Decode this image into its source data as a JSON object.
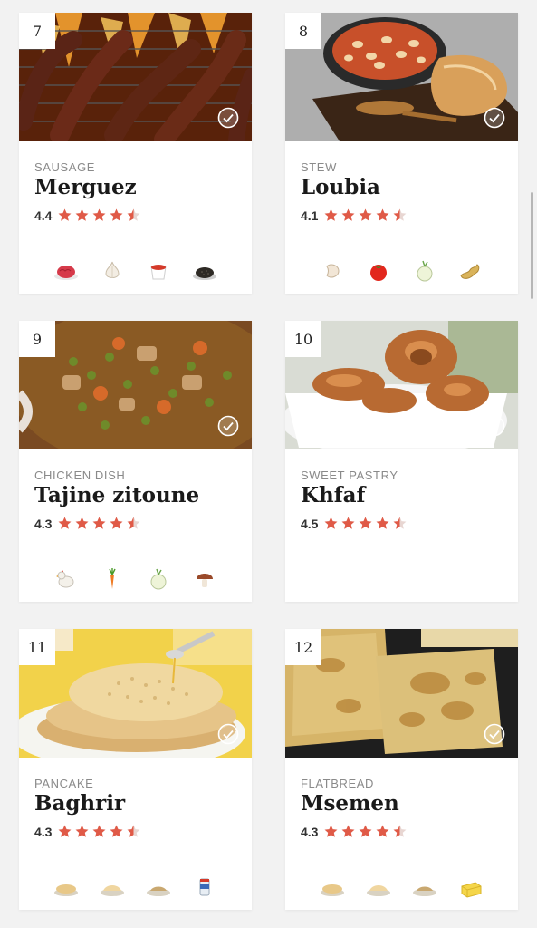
{
  "dishes": [
    {
      "rank": "7",
      "category": "SAUSAGE",
      "name": "Merguez",
      "rating": "4.4",
      "stars": 4.5,
      "photo": "grilled-sausages",
      "ingredients": [
        "ground-meat-icon",
        "garlic-icon",
        "tomato-paste-icon",
        "spice-icon"
      ]
    },
    {
      "rank": "8",
      "category": "STEW",
      "name": "Loubia",
      "rating": "4.1",
      "stars": 4.5,
      "photo": "bean-stew",
      "ingredients": [
        "white-bean-icon",
        "tomato-icon",
        "onion-icon",
        "ginger-icon"
      ]
    },
    {
      "rank": "9",
      "category": "CHICKEN DISH",
      "name": "Tajine zitoune",
      "rating": "4.3",
      "stars": 4.5,
      "photo": "chicken-olive-tajine",
      "ingredients": [
        "chicken-icon",
        "carrot-icon",
        "onion-icon",
        "mushroom-icon"
      ]
    },
    {
      "rank": "10",
      "category": "SWEET PASTRY",
      "name": "Khfaf",
      "rating": "4.5",
      "stars": 4.5,
      "photo": "fried-dough-rings",
      "ingredients": []
    },
    {
      "rank": "11",
      "category": "PANCAKE",
      "name": "Baghrir",
      "rating": "4.3",
      "stars": 4.5,
      "photo": "honeycomb-pancakes",
      "ingredients": [
        "semolina-icon",
        "flour-icon",
        "yeast-icon",
        "baking-powder-icon"
      ]
    },
    {
      "rank": "12",
      "category": "FLATBREAD",
      "name": "Msemen",
      "rating": "4.3",
      "stars": 4.5,
      "photo": "square-flatbreads",
      "ingredients": [
        "semolina-icon",
        "flour-icon",
        "yeast-icon",
        "butter-icon"
      ]
    }
  ],
  "colors": {
    "star": "#e05a47",
    "star_empty": "#e8d6d2",
    "background": "#f2f2f2",
    "card": "#ffffff"
  }
}
